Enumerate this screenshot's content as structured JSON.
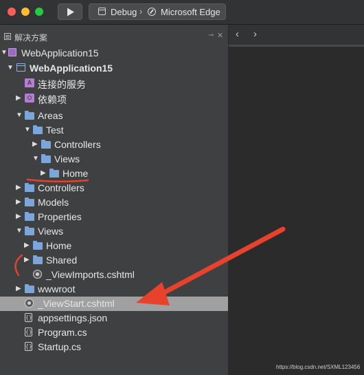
{
  "toolbar": {
    "run_button": "play-icon",
    "config": "Debug",
    "separator": "›",
    "target": "Microsoft Edge"
  },
  "pad": {
    "title": "解决方案",
    "pin": "📌",
    "close": "✕"
  },
  "tree": [
    {
      "label": "WebApplication15",
      "kind": "solution"
    },
    {
      "label": "WebApplication15",
      "kind": "project"
    },
    {
      "label": "连接的服务",
      "kind": "connected-services"
    },
    {
      "label": "依赖项",
      "kind": "dependencies"
    },
    {
      "label": "Areas",
      "kind": "folder"
    },
    {
      "label": "Test",
      "kind": "folder"
    },
    {
      "label": "Controllers",
      "kind": "folder"
    },
    {
      "label": "Views",
      "kind": "folder"
    },
    {
      "label": "Home",
      "kind": "folder"
    },
    {
      "label": "Controllers",
      "kind": "folder"
    },
    {
      "label": "Models",
      "kind": "folder"
    },
    {
      "label": "Properties",
      "kind": "folder"
    },
    {
      "label": "Views",
      "kind": "folder"
    },
    {
      "label": "Home",
      "kind": "folder"
    },
    {
      "label": "Shared",
      "kind": "folder"
    },
    {
      "label": "_ViewImports.cshtml",
      "kind": "cshtml"
    },
    {
      "label": "wwwroot",
      "kind": "folder"
    },
    {
      "label": "_ViewStart.cshtml",
      "kind": "cshtml",
      "selected": true
    },
    {
      "label": "appsettings.json",
      "kind": "file"
    },
    {
      "label": "Program.cs",
      "kind": "file"
    },
    {
      "label": "Startup.cs",
      "kind": "file"
    }
  ],
  "editor": {
    "back": "‹",
    "forward": "›"
  },
  "watermark": "https://blog.csdn.net/SXML123456",
  "colors": {
    "annotation": "#e8412c",
    "folder": "#7ba6dc",
    "selection": "#a0a0a0"
  }
}
